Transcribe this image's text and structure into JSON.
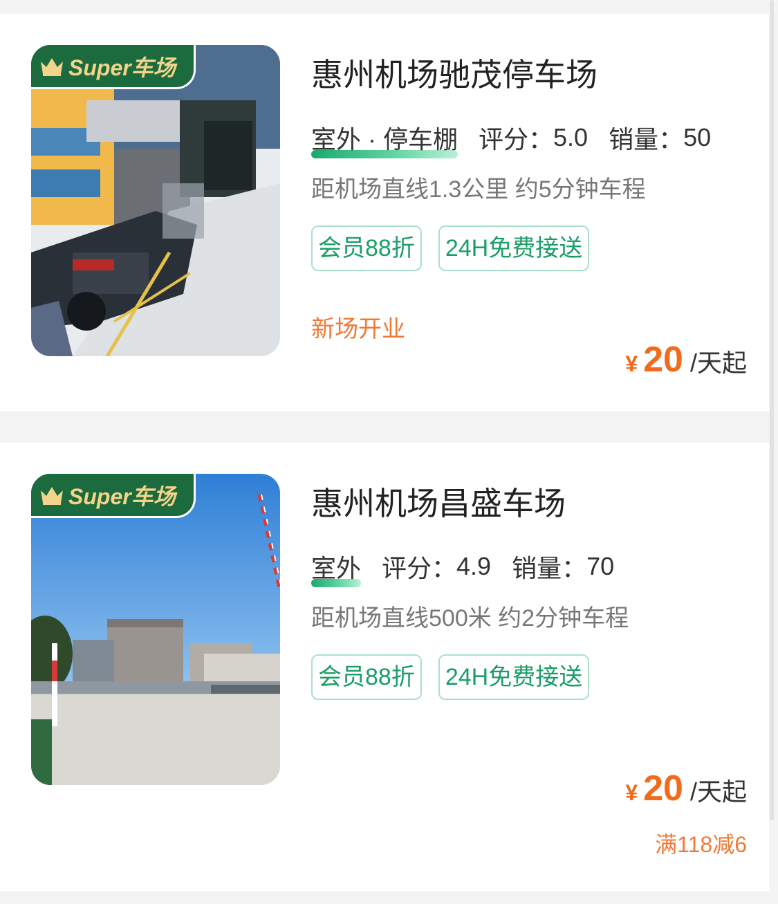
{
  "badge": {
    "label": "Super车场"
  },
  "listings": [
    {
      "title": "惠州机场驰茂停车场",
      "type": "室外 · 停车棚",
      "rating_label": "评分：",
      "rating": "5.0",
      "sales_label": "销量：",
      "sales": "50",
      "distance": "距机场直线1.3公里 约5分钟车程",
      "tags": [
        "会员88折",
        "24H免费接送"
      ],
      "promo_left": "新场开业",
      "price": {
        "currency": "¥",
        "amount": "20",
        "unit": "/天起"
      },
      "image_icon": "parking-garage-photo"
    },
    {
      "title": "惠州机场昌盛车场",
      "type": "室外",
      "rating_label": "评分：",
      "rating": "4.9",
      "sales_label": "销量：",
      "sales": "70",
      "distance": "距机场直线500米 约2分钟车程",
      "tags": [
        "会员88折",
        "24H免费接送"
      ],
      "promo_right": "满118减6",
      "price": {
        "currency": "¥",
        "amount": "20",
        "unit": "/天起"
      },
      "image_icon": "open-parking-lot-photo"
    }
  ],
  "colors": {
    "accent_green": "#1a9e66",
    "badge_green": "#1b6b3e",
    "price_orange": "#f26a1b",
    "promo_orange": "#f07a35"
  }
}
